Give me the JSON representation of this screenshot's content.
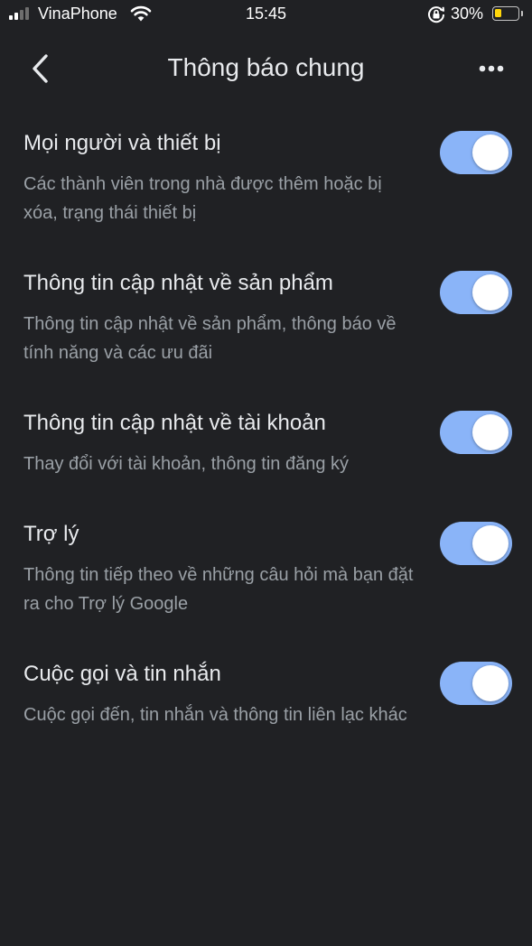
{
  "status_bar": {
    "carrier": "VinaPhone",
    "time": "15:45",
    "battery_percent": "30%",
    "battery_level": 0.3,
    "battery_color": "#ffd60a",
    "signal_bars_active": 2,
    "signal_bars_total": 4
  },
  "header": {
    "title": "Thông báo chung",
    "back_icon": "chevron-left-icon",
    "more_icon": "more-horizontal-icon"
  },
  "colors": {
    "background": "#202124",
    "toggle_on_track": "#8ab4f8",
    "title_text": "#e8eaed",
    "description_text": "#9aa0a6"
  },
  "settings": [
    {
      "title": "Mọi người và thiết bị",
      "description": "Các thành viên trong nhà được thêm hoặc bị xóa, trạng thái thiết bị",
      "enabled": true
    },
    {
      "title": "Thông tin cập nhật về sản phẩm",
      "description": "Thông tin cập nhật về sản phẩm, thông báo về tính năng và các ưu đãi",
      "enabled": true
    },
    {
      "title": "Thông tin cập nhật về tài khoản",
      "description": "Thay đổi với tài khoản, thông tin đăng ký",
      "enabled": true
    },
    {
      "title": "Trợ lý",
      "description": "Thông tin tiếp theo về những câu hỏi mà bạn đặt ra cho Trợ lý Google",
      "enabled": true
    },
    {
      "title": "Cuộc gọi và tin nhắn",
      "description": "Cuộc gọi đến, tin nhắn và thông tin liên lạc khác",
      "enabled": true
    }
  ]
}
